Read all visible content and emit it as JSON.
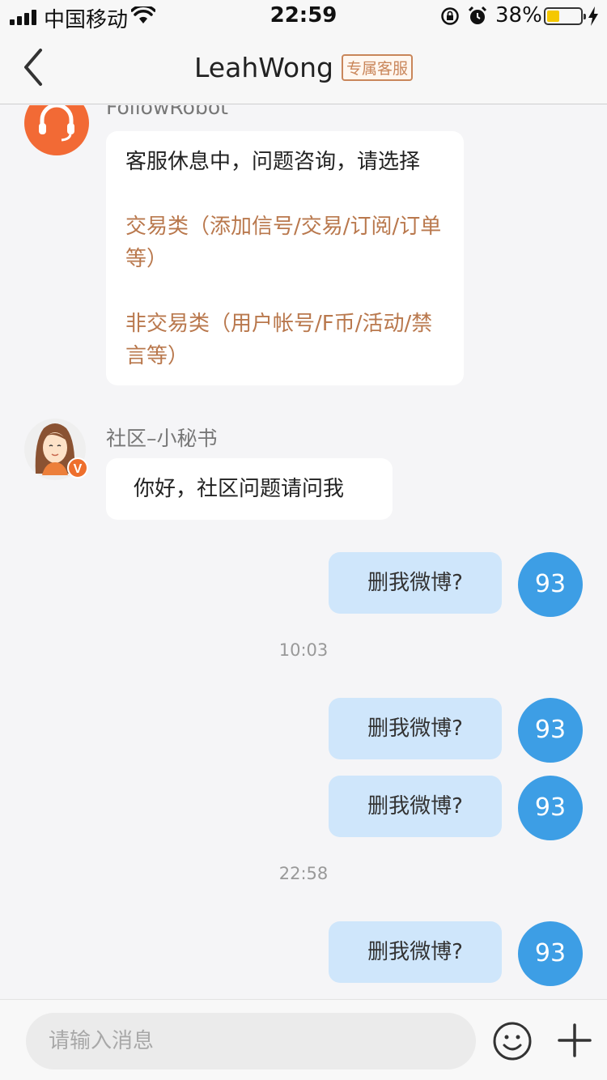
{
  "status_bar": {
    "carrier": "中国移动",
    "time": "22:59",
    "battery_percent": "38%",
    "battery_level": 0.38,
    "battery_color": "#f5c800"
  },
  "nav": {
    "title": "LeahWong",
    "badge": "专属客服",
    "back_icon": "chevron-left-icon"
  },
  "messages": {
    "robot": {
      "name": "FollowRobot",
      "avatar_icon": "headset-icon",
      "text": "客服休息中，问题咨询，请选择",
      "option1": "交易类（添加信号/交易/订阅/订单等）",
      "option2": "非交易类（用户帐号/F币/活动/禁言等）"
    },
    "secretary": {
      "name": "社区–小秘书",
      "text": "你好，社区问题请问我",
      "badge": "V"
    },
    "outgoing": [
      {
        "text": "删我微博?",
        "avatar": "93"
      },
      {
        "text": "删我微博?",
        "avatar": "93"
      },
      {
        "text": "删我微博?",
        "avatar": "93"
      },
      {
        "text": "删我微博?",
        "avatar": "93"
      }
    ],
    "timestamps": [
      "10:03",
      "22:58"
    ]
  },
  "input": {
    "placeholder": "请输入消息",
    "emoji_icon": "smiley-icon",
    "plus_icon": "plus-icon"
  },
  "colors": {
    "accent_orange": "#f26a35",
    "option_text": "#b9784d",
    "outgoing_bubble": "#cfe6fb",
    "my_avatar": "#3d9ee5"
  }
}
